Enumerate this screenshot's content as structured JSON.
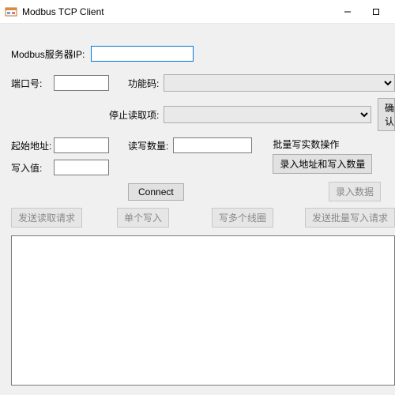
{
  "window": {
    "title": "Modbus TCP Client"
  },
  "labels": {
    "server_ip": "Modbus服务器IP:",
    "port": "端口号:",
    "func_code": "功能码:",
    "stop_read": "停止读取项:",
    "start_addr": "起始地址:",
    "rw_count": "读写数量:",
    "write_val": "写入值:",
    "batch_title": "批量写实数操作"
  },
  "buttons": {
    "confirm": "确认",
    "record_addr_count": "录入地址和写入数量",
    "record_data": "录入数据",
    "connect": "Connect",
    "send_read_req": "发送读取请求",
    "single_write": "单个写入",
    "write_coils": "写多个线圈",
    "send_batch_write": "发送批量写入请求"
  },
  "values": {
    "server_ip": "",
    "port": "",
    "func_code": "",
    "stop_read": "",
    "start_addr": "",
    "rw_count": "",
    "write_val": ""
  }
}
